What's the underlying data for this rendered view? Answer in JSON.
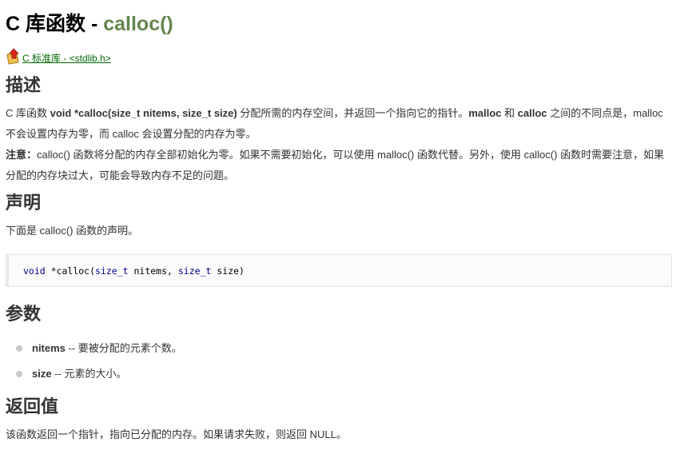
{
  "title": {
    "prefix": "C 库函数 - ",
    "function": "calloc()"
  },
  "back_link": {
    "icon": "up-arrow-icon",
    "label": " C 标准库 - <stdlib.h>"
  },
  "sections": {
    "description": {
      "heading": "描述",
      "p1": {
        "t1": "C 库函数 ",
        "b1": "void *calloc(size_t nitems, size_t size)",
        "t2": " 分配所需的内存空间，并返回一个指向它的指针。",
        "b2": "malloc",
        "t3": " 和 ",
        "b3": "calloc",
        "t4": " 之间的不同点是，malloc 不会设置内存为零，而 calloc 会设置分配的内存为零。"
      },
      "p2": {
        "b1": "注意：",
        "t1": "calloc() 函数将分配的内存全部初始化为零。如果不需要初始化，可以使用 malloc() 函数代替。另外，使用 calloc() 函数时需要注意，如果分配的内存块过大，可能会导致内存不足的问题。"
      }
    },
    "declaration": {
      "heading": "声明",
      "intro": "下面是 calloc() 函数的声明。",
      "code": {
        "kw1": "void",
        "t1": " *calloc(",
        "kw2": "size_t",
        "t2": " nitems, ",
        "kw3": "size_t",
        "t3": " size)"
      }
    },
    "parameters": {
      "heading": "参数",
      "items": [
        {
          "name": "nitems",
          "desc": " -- 要被分配的元素个数。"
        },
        {
          "name": "size",
          "desc": " -- 元素的大小。"
        }
      ]
    },
    "return_value": {
      "heading": "返回值",
      "text": "该函数返回一个指针，指向已分配的内存。如果请求失败，则返回 NULL。"
    }
  }
}
